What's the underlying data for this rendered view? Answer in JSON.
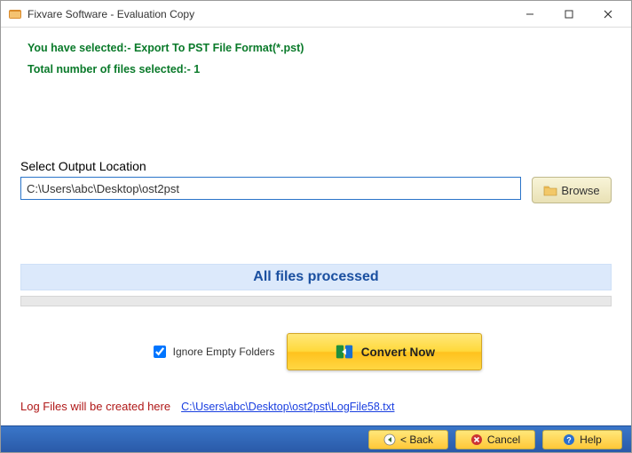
{
  "window": {
    "title": "Fixvare Software - Evaluation Copy"
  },
  "info": {
    "line1": "You have selected:- Export To PST File Format(*.pst)",
    "line2": "Total number of files selected:- 1"
  },
  "output": {
    "label": "Select Output Location",
    "path": "C:\\Users\\abc\\Desktop\\ost2pst",
    "browse": "Browse"
  },
  "status": {
    "text": "All files processed"
  },
  "actions": {
    "ignore_empty": "Ignore Empty Folders",
    "ignore_empty_checked": true,
    "convert": "Convert Now"
  },
  "log": {
    "label": "Log Files will be created here",
    "link": "C:\\Users\\abc\\Desktop\\ost2pst\\LogFile58.txt"
  },
  "footer": {
    "back": "< Back",
    "cancel": "Cancel",
    "help": "Help"
  }
}
